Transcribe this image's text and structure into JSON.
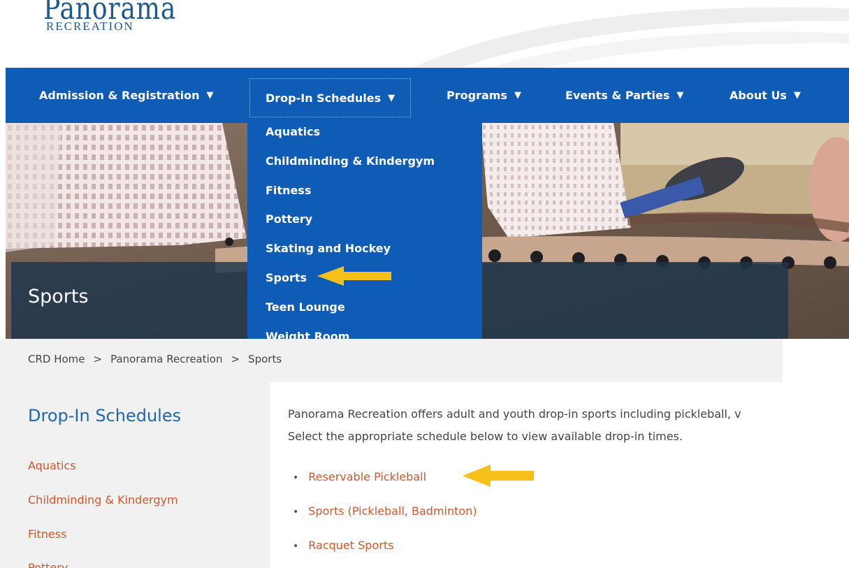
{
  "logo": {
    "script": "Panorama",
    "sub": "RECREATION"
  },
  "nav": {
    "items": [
      {
        "label": "Admission & Registration"
      },
      {
        "label": "Drop-In Schedules"
      },
      {
        "label": "Programs"
      },
      {
        "label": "Events & Parties"
      },
      {
        "label": "About Us"
      }
    ],
    "arrow": "▼"
  },
  "dropdown": {
    "items": [
      "Aquatics",
      "Childminding & Kindergym",
      "Fitness",
      "Pottery",
      "Skating and Hockey",
      "Sports",
      "Teen Lounge",
      "Weight Room"
    ]
  },
  "hero": {
    "title": "Sports"
  },
  "breadcrumb": {
    "items": [
      "CRD Home",
      "Panorama Recreation",
      "Sports"
    ],
    "separator": ">"
  },
  "sidebar": {
    "title": "Drop-In Schedules",
    "items": [
      "Aquatics",
      "Childminding & Kindergym",
      "Fitness",
      "Pottery"
    ]
  },
  "main": {
    "intro_line1": "Panorama Recreation offers adult and youth drop-in sports including pickleball, v",
    "intro_line2": "Select the appropriate schedule below to view available drop-in times.",
    "links": [
      "Reservable Pickleball",
      "Sports (Pickleball, Badminton)",
      "Racquet Sports"
    ],
    "bullet": "•"
  },
  "colors": {
    "nav_blue": "#0e5cb5",
    "link_orange": "#d2562a",
    "heading_blue": "#1f67b1",
    "annotation_yellow": "#f5c018"
  }
}
